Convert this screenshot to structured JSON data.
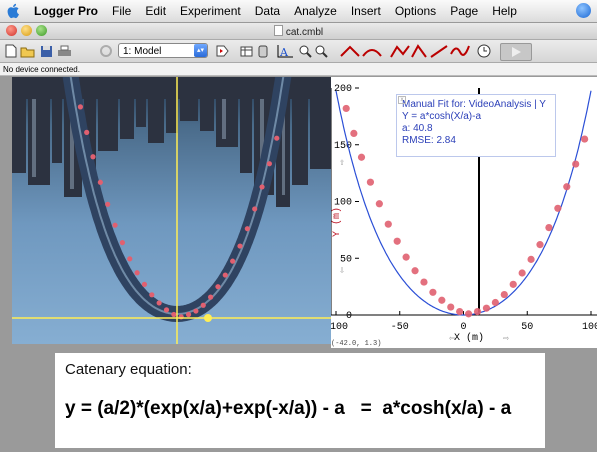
{
  "menubar": {
    "app_name": "Logger Pro",
    "items": [
      "File",
      "Edit",
      "Experiment",
      "Data",
      "Analyze",
      "Insert",
      "Options",
      "Page",
      "Help"
    ]
  },
  "window": {
    "title": "cat.cmbl"
  },
  "toolbar": {
    "page_select": "1: Model"
  },
  "status": {
    "device": "No device connected."
  },
  "fit_box": {
    "line1": "Manual Fit for:  VideoAnalysis | Y",
    "line2": "Y = a*cosh(X/a)-a",
    "line3": "a: 40.8",
    "line4": "RMSE: 2.84"
  },
  "graph": {
    "ylabel": "Y (m)",
    "xlabel": "X (m)",
    "xticks": [
      "-100",
      "-50",
      "0",
      "50",
      "100"
    ],
    "yticks": [
      "0",
      "50",
      "100",
      "150",
      "200"
    ],
    "coords": "(-42.0, 1.3)"
  },
  "note": {
    "title": "Catenary equation:",
    "equation": "y = (a/2)*(exp(x/a)+exp(-x/a)) - a   =  a*cosh(x/a) - a"
  },
  "colors": {
    "fit_line": "#2b4fd6",
    "points": "#e06070",
    "crosshair": "#ffee55"
  },
  "chart_data": {
    "type": "scatter",
    "a": 40.8,
    "xlim": [
      -100,
      100
    ],
    "ylim": [
      0,
      200
    ],
    "x": [
      -92,
      -86,
      -80,
      -73,
      -66,
      -59,
      -52,
      -45,
      -38,
      -31,
      -24,
      -17,
      -10,
      -3,
      4,
      11,
      18,
      25,
      32,
      39,
      46,
      53,
      60,
      67,
      74,
      81,
      88,
      95
    ],
    "y": [
      182,
      160,
      139,
      117,
      98,
      80,
      65,
      51,
      39,
      29,
      20,
      13,
      7,
      3,
      1,
      3,
      6,
      11,
      18,
      27,
      37,
      49,
      62,
      77,
      94,
      113,
      133,
      155
    ]
  }
}
